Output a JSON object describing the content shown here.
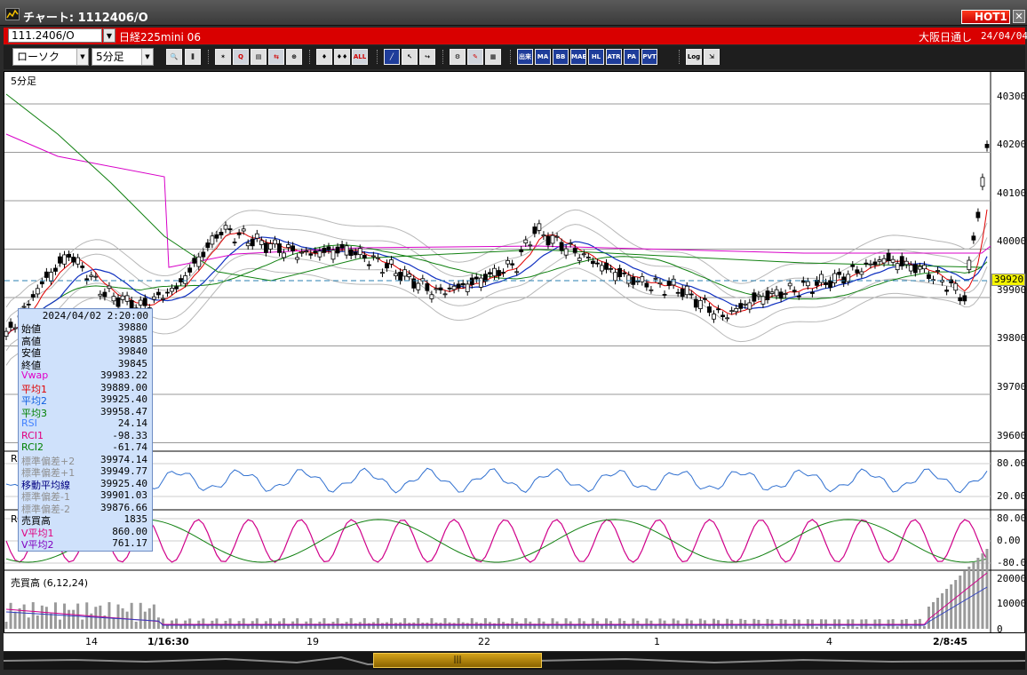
{
  "window": {
    "title": "チャート: 1112406/O",
    "hot_label": "HOT1",
    "close_label": "✕"
  },
  "infobar": {
    "symbol": "111.2406/O",
    "instrument": "日経225mini 06",
    "market": "大阪日通し",
    "date": "24/04/04"
  },
  "toolbar": {
    "chart_type": "ローソク",
    "interval": "5分足",
    "buttons": [
      {
        "name": "zoom-button",
        "label": "🔍"
      },
      {
        "name": "split-button",
        "label": "⫼"
      },
      {
        "name": "tool-1",
        "label": "✶"
      },
      {
        "name": "tool-2",
        "label": "Q"
      },
      {
        "name": "tool-3",
        "label": "▤"
      },
      {
        "name": "tool-4",
        "label": "⇆"
      },
      {
        "name": "tool-5",
        "label": "⊕"
      },
      {
        "name": "candle-1",
        "label": "♦"
      },
      {
        "name": "candle-2",
        "label": "♦♦"
      },
      {
        "name": "all-button",
        "label": "ALL"
      },
      {
        "name": "draw-line-button",
        "label": "╱"
      },
      {
        "name": "pointer-button",
        "label": "↖"
      },
      {
        "name": "arrow-button",
        "label": "↪"
      },
      {
        "name": "settings-button",
        "label": "⚙"
      },
      {
        "name": "pen-button",
        "label": "✎"
      },
      {
        "name": "color-button",
        "label": "▦"
      },
      {
        "name": "vol-button",
        "label": "出来"
      },
      {
        "name": "ma-button",
        "label": "MA"
      },
      {
        "name": "bb-button",
        "label": "BB"
      },
      {
        "name": "mae-button",
        "label": "MAE"
      },
      {
        "name": "hl-button",
        "label": "HL"
      },
      {
        "name": "atr-button",
        "label": "ATR"
      },
      {
        "name": "para-button",
        "label": "PA RA"
      },
      {
        "name": "pvt-button",
        "label": "PVT"
      },
      {
        "name": "log-button",
        "label": "Log"
      },
      {
        "name": "export-button",
        "label": "⇲"
      }
    ]
  },
  "chart": {
    "panel_label": "5分足",
    "rsi_label": "RS",
    "rci_label": "RC",
    "volume_label": "売買高 (6,12,24)",
    "price_ticks": [
      "40300",
      "40200",
      "40100",
      "40000",
      "39900",
      "39800",
      "39700",
      "39600"
    ],
    "current_price": "39920",
    "rsi_ticks": [
      "80.00",
      "20.00"
    ],
    "rci_ticks": [
      "80.00",
      "0.00",
      "-80.00"
    ],
    "volume_ticks": [
      "20000",
      "10000",
      "0"
    ],
    "x_labels": [
      "14",
      "1/16:30",
      "19",
      "22",
      "1",
      "4",
      "2/8:45"
    ]
  },
  "tooltip": {
    "timestamp": "2024/04/02  2:20:00",
    "rows": [
      {
        "k": "始値",
        "v": "39880",
        "c": "#000000"
      },
      {
        "k": "高値",
        "v": "39885",
        "c": "#000000"
      },
      {
        "k": "安値",
        "v": "39840",
        "c": "#000000"
      },
      {
        "k": "終値",
        "v": "39845",
        "c": "#000000"
      },
      {
        "k": "Vwap",
        "v": "39983.22",
        "c": "#e000c8"
      },
      {
        "k": "平均1",
        "v": "39889.00",
        "c": "#e00000"
      },
      {
        "k": "平均2",
        "v": "39925.40",
        "c": "#1060e0"
      },
      {
        "k": "平均3",
        "v": "39958.47",
        "c": "#008000"
      },
      {
        "k": "RSI",
        "v": "24.14",
        "c": "#4080ff"
      },
      {
        "k": "RCI1",
        "v": "-98.33",
        "c": "#e00080"
      },
      {
        "k": "RCI2",
        "v": "-61.74",
        "c": "#008000"
      },
      {
        "k": "標準偏差+2",
        "v": "39974.14",
        "c": "#909090"
      },
      {
        "k": "標準偏差+1",
        "v": "39949.77",
        "c": "#909090"
      },
      {
        "k": "移動平均線",
        "v": "39925.40",
        "c": "#000080"
      },
      {
        "k": "標準偏差-1",
        "v": "39901.03",
        "c": "#909090"
      },
      {
        "k": "標準偏差-2",
        "v": "39876.66",
        "c": "#909090"
      },
      {
        "k": "売買高",
        "v": "1835",
        "c": "#000000"
      },
      {
        "k": "V平均1",
        "v": "860.00",
        "c": "#e00080"
      },
      {
        "k": "V平均2",
        "v": "761.17",
        "c": "#8000c0"
      }
    ]
  }
}
